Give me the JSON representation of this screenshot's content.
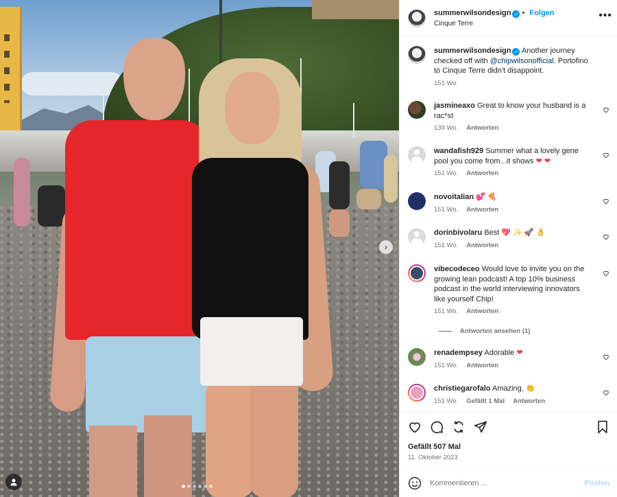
{
  "post": {
    "username": "summerwilsondesign",
    "follow_label": "Folgen",
    "location": "Cinque Terre",
    "more_label": "•••",
    "caption_pre": "Another journey checked off with ",
    "caption_mention": "@chipwilsonofficial",
    "caption_post": ". Portofino to Cinque Terre didn't disappoint.",
    "caption_age": "151 Wo.",
    "likes": "Gefällt 507 Mal",
    "date": "11. Oktober 2023",
    "add_comment_placeholder": "Kommentieren ...",
    "post_button": "Posten",
    "carousel_dots": 6,
    "carousel_active": 0
  },
  "reply_label": "Antworten",
  "comments": [
    {
      "user": "jasmineaxo",
      "text": "Great to know your husband is a rac*st",
      "age": "139 Wo.",
      "extra": ""
    },
    {
      "user": "wandafish929",
      "text": "Summer what a lovely gene pool you come from...it shows",
      "emoji": "❤ ❤",
      "age": "151 Wo.",
      "extra": ""
    },
    {
      "user": "novoitalian",
      "text": "",
      "emoji": "💕 🍕",
      "age": "151 Wo.",
      "extra": ""
    },
    {
      "user": "dorinbivolaru",
      "text": "Best",
      "emoji": "💖 ✨ 🚀 👌",
      "age": "151 Wo.",
      "extra": ""
    },
    {
      "user": "vibecodeceo",
      "text": "Would love to invite you on the growing lean podcast! A top 10% business podcast in the world interviewing innovators like yourself Chip!",
      "age": "151 Wo.",
      "extra": ""
    },
    {
      "user": "renadempsey",
      "text": "Adorable",
      "emoji": "❤",
      "age": "151 Wo.",
      "extra": ""
    },
    {
      "user": "christiegarofalo",
      "text": "Amazing.",
      "emoji": "👏",
      "age": "151 Wo.",
      "extra": "Gefällt 1 Mal"
    }
  ],
  "view_replies": "Antworten ansehen (1)",
  "colors": {
    "accent": "#0095f6",
    "like_heart": "#ed3a5a",
    "muted": "#737373"
  },
  "icons": [
    "like-icon",
    "comment-icon",
    "share-icon",
    "send-icon",
    "bookmark-icon",
    "emoji-icon",
    "heart-outline-icon",
    "tag-user-icon",
    "next-arrow-icon"
  ]
}
